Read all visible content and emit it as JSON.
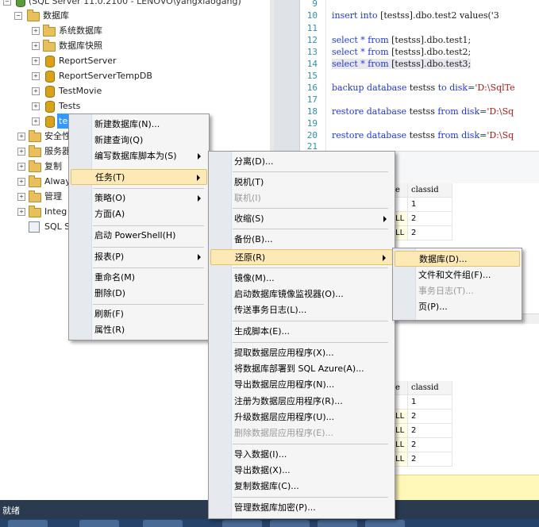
{
  "tree": {
    "server_node": "(SQL Server 11.0.2100 - LENOVO\\yangxiaogang)",
    "items": [
      {
        "label": "数据库",
        "indent": 0,
        "icon": "folder",
        "expander": "−"
      },
      {
        "label": "系统数据库",
        "icon": "folder",
        "expander": "+"
      },
      {
        "label": "数据库快照",
        "icon": "folder",
        "expander": "+"
      },
      {
        "label": "ReportServer",
        "icon": "database",
        "expander": "+"
      },
      {
        "label": "ReportServerTempDB",
        "icon": "database",
        "expander": "+"
      },
      {
        "label": "TestMovie",
        "icon": "database",
        "expander": "+"
      },
      {
        "label": "Tests",
        "icon": "database",
        "expander": "+"
      },
      {
        "label": "tes",
        "icon": "database",
        "expander": "+"
      },
      {
        "label": "安全性",
        "icon": "folder",
        "expander": "+"
      },
      {
        "label": "服务器",
        "icon": "folder",
        "expander": "+"
      },
      {
        "label": "复制",
        "icon": "folder",
        "expander": "+"
      },
      {
        "label": "Alway",
        "icon": "folder",
        "expander": "+"
      },
      {
        "label": "管理",
        "icon": "folder",
        "expander": "+"
      },
      {
        "label": "Integ",
        "icon": "folder",
        "expander": "+"
      },
      {
        "label": "SQL S",
        "icon": "sql-agent",
        "expander": ""
      }
    ]
  },
  "editor": {
    "line_numbers": [
      "9",
      "10",
      "11",
      "12",
      "13",
      "14",
      "15",
      "16",
      "17",
      "18",
      "19",
      "20",
      "21"
    ],
    "lines": {
      "l10_kw": "insert into ",
      "l10_rest": "[testss].dbo.test2 values('3",
      "l12_kw": "select * from ",
      "l12_rest": "[testss].dbo.test1;",
      "l13_kw": "select * from ",
      "l13_rest": "[testss].dbo.test2;",
      "l14_kw": "select * from ",
      "l14_rest": "[testss].dbo.test3;",
      "l16_kw": "backup database ",
      "l16_mid": "testss ",
      "l16_kw2": "to disk=",
      "l16_str": "'D:\\SqlTe",
      "l18_kw": "restore database ",
      "l18_mid": "testss ",
      "l18_kw2": "from disk=",
      "l18_str": "'D:\\Sq",
      "l20_kw": "restore database ",
      "l20_mid": "testss ",
      "l20_kw2": "from disk=",
      "l20_str": "'D:\\Sq"
    }
  },
  "grid1": {
    "col_partial": "e",
    "col_header": "classid",
    "rows": [
      {
        "a": "",
        "b": "1"
      },
      {
        "a": "LL",
        "b": "2"
      },
      {
        "a": "LL",
        "b": "2"
      }
    ]
  },
  "grid2": {
    "col_partial": "e",
    "col_header": "classid",
    "rows": [
      {
        "a": "",
        "b": "1"
      },
      {
        "a": "LL",
        "b": "2"
      },
      {
        "a": "LL",
        "b": "2"
      },
      {
        "a": "LL",
        "b": "2"
      },
      {
        "a": "LL",
        "b": "2"
      }
    ]
  },
  "status": {
    "text": "就绪"
  },
  "menu1": {
    "items": [
      "新建数据库(N)...",
      "新建查询(Q)",
      "编写数据库脚本为(S)",
      "任务(T)",
      "策略(O)",
      "方面(A)",
      "启动 PowerShell(H)",
      "报表(P)",
      "重命名(M)",
      "删除(D)",
      "刷新(F)",
      "属性(R)"
    ]
  },
  "menu2": {
    "items": [
      "分离(D)...",
      "脱机(T)",
      "联机(I)",
      "收缩(S)",
      "备份(B)...",
      "还原(R)",
      "镜像(M)...",
      "启动数据库镜像监视器(O)...",
      "传送事务日志(L)...",
      "生成脚本(E)...",
      "提取数据层应用程序(X)...",
      "将数据库部署到 SQL Azure(A)...",
      "导出数据层应用程序(N)...",
      "注册为数据层应用程序(R)...",
      "升级数据层应用程序(U)...",
      "删除数据层应用程序(E)...",
      "导入数据(I)...",
      "导出数据(X)...",
      "复制数据库(C)...",
      "管理数据库加密(P)..."
    ]
  },
  "menu3": {
    "items": [
      "数据库(D)...",
      "文件和文件组(F)...",
      "事务日志(T)...",
      "页(P)..."
    ]
  }
}
